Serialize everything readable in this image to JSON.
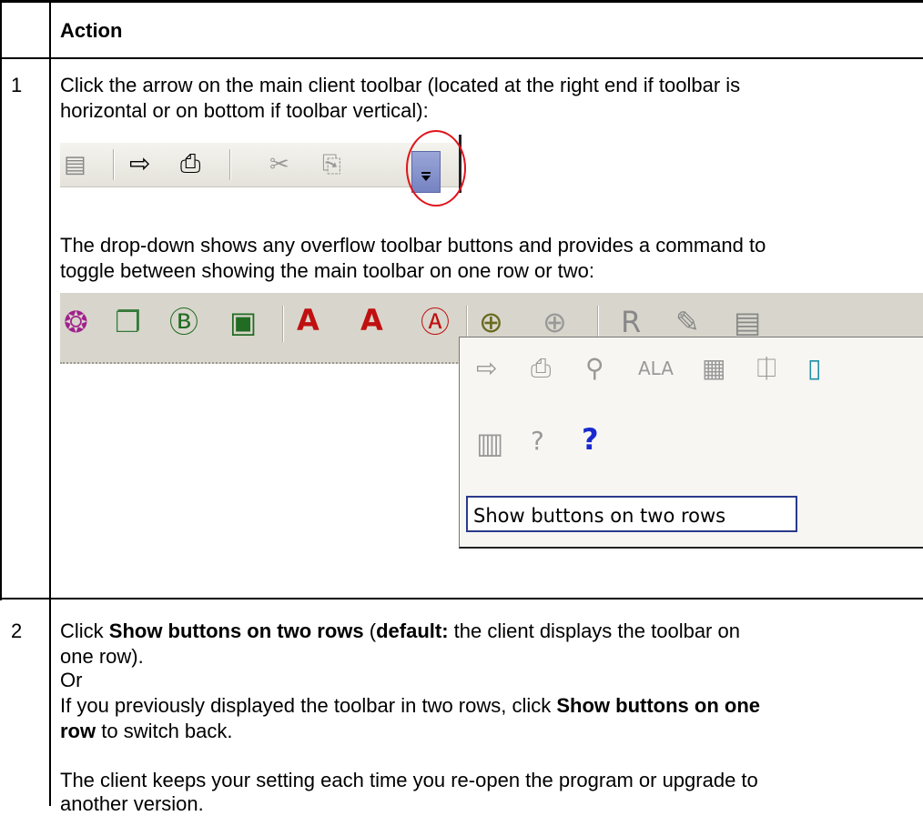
{
  "table": {
    "header": "Action",
    "rows": [
      {
        "num": "1",
        "text1_line1": "Click the arrow on the main client toolbar (located at the right end if toolbar is",
        "text1_line2": "horizontal or on bottom if toolbar vertical):",
        "text2_line1": "The drop-down shows any overflow toolbar buttons and provides a command to",
        "text2_line2": "toggle between showing the main toolbar on one row or two:"
      },
      {
        "num": "2",
        "click": "Click ",
        "show_two": "Show buttons on two rows",
        "paren_open": " (",
        "default_label": "default:",
        "default_text": " the client displays the toolbar on",
        "line2": "one row).",
        "or": "Or",
        "prev_line1": "If you previously displayed the toolbar in two rows, click ",
        "show_one_a": "Show buttons on one",
        "show_one_b": "row",
        "prev_line2": " to switch back.",
        "keep_line1": "The client keeps your setting each time you re-open the program or upgrade to",
        "keep_line2": "another version."
      }
    ]
  },
  "screenshot": {
    "command_label": "Show buttons on two rows",
    "icons_top": [
      "table-icon",
      "export-icon",
      "print-icon",
      "cut-icon",
      "copy-icon",
      "overflow-arrow-icon"
    ],
    "icons_row": [
      "color-icon",
      "layers-icon",
      "b-node-icon",
      "b-box-icon",
      "a-node-icon",
      "a-layer-icon",
      "a-box-icon",
      "connector-icon",
      "connector-disabled-icon",
      "r-icon",
      "check-icon",
      "table-icon"
    ],
    "icons_overflow": [
      "export-icon",
      "print-icon",
      "find-icon",
      "ala-icon",
      "grid-icon",
      "db-icon",
      "doc-icon",
      "report-icon",
      "help-doc-icon",
      "help-icon"
    ],
    "highlight_color": "#e0141c",
    "accent_color": "#7583c2"
  }
}
